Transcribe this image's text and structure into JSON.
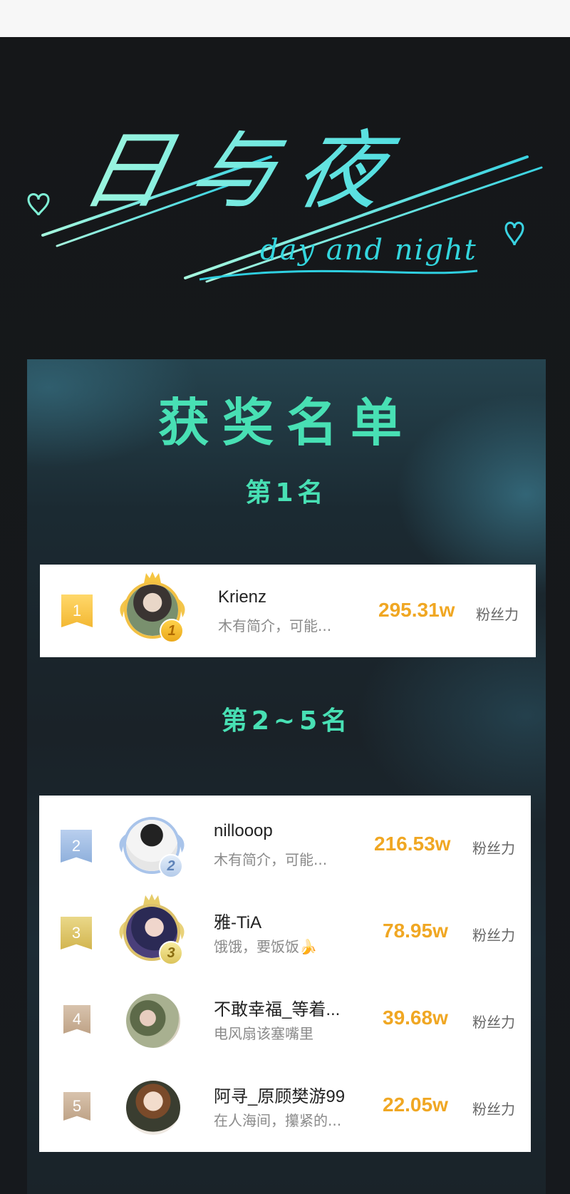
{
  "logo": {
    "chinese": "日与夜",
    "english": "day and night"
  },
  "panel": {
    "title": "获奖名单",
    "section_first": "第1名",
    "section_rest": "第2~5名"
  },
  "winners": [
    {
      "rank": "1",
      "name": "Krienz",
      "desc": "木有简介，可能...",
      "score": "295.31w",
      "unit": "粉丝力"
    },
    {
      "rank": "2",
      "name": "nillooop",
      "desc": "木有简介，可能...",
      "score": "216.53w",
      "unit": "粉丝力"
    },
    {
      "rank": "3",
      "name": "雅-TiA",
      "desc": "饿饿，要饭饭🍌",
      "score": "78.95w",
      "unit": "粉丝力"
    },
    {
      "rank": "4",
      "name": "不敢幸福_等着...",
      "desc": "电风扇该塞嘴里",
      "score": "39.68w",
      "unit": "粉丝力"
    },
    {
      "rank": "5",
      "name": "阿寻_原顾樊游99",
      "desc": "在人海间，攥紧的...",
      "score": "22.05w",
      "unit": "粉丝力"
    }
  ],
  "colors": {
    "accent": "#48e0b4",
    "score": "#f0a723",
    "gold": "#f5c542",
    "silver": "#9fbadf",
    "bronze": "#cbb08a"
  }
}
